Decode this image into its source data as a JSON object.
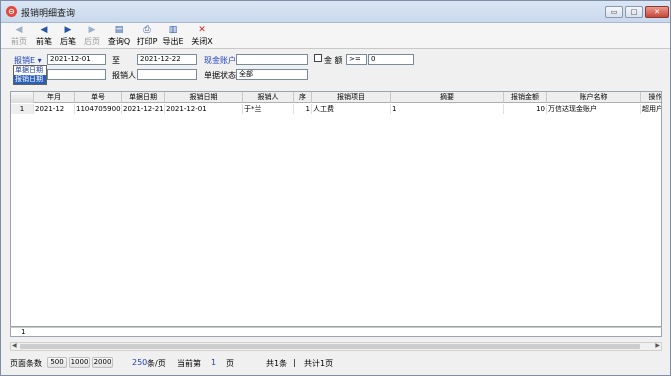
{
  "window": {
    "title": "报销明细查询",
    "app_icon_glyph": "⊖",
    "controls": {
      "minimize": "▭",
      "maximize": "□",
      "close": "✕"
    }
  },
  "toolbar": {
    "first": {
      "label": "前页",
      "icon": "◀"
    },
    "prev": {
      "label": "前笔",
      "icon": "◀"
    },
    "next": {
      "label": "后笔",
      "icon": "▶"
    },
    "last": {
      "label": "后页",
      "icon": "▶"
    },
    "query": {
      "label": "查询Q",
      "icon": "▤"
    },
    "print": {
      "label": "打印P",
      "icon": "⎙"
    },
    "export": {
      "label": "导出E",
      "icon": "▥"
    },
    "close": {
      "label": "关闭X",
      "icon": "✕"
    }
  },
  "filters": {
    "date_type": {
      "value": "报销E",
      "arrow": "▾"
    },
    "date_type_options": [
      "单据日期",
      "报销日期"
    ],
    "date_from": "2021-12-01",
    "to_label": "至",
    "date_to": "2021-12-22",
    "account_label": "现金账户",
    "account_value": "",
    "amount_label": "金 额",
    "amount_operator": ">=",
    "amount_value": "0",
    "reimburser_label": "报销人",
    "reimburser_value": "",
    "doc_status_label": "单据状态",
    "doc_status_value": "全部",
    "extra_value": ""
  },
  "grid": {
    "columns": [
      "年月",
      "单号",
      "单据日期",
      "报销日期",
      "报销人",
      "序",
      "报销项目",
      "摘要",
      "报销金额",
      "账户名称",
      "操作"
    ],
    "rows": [
      {
        "num": "1",
        "cells": [
          "2021-12",
          "1104705900",
          "2021-12-21",
          "2021-12-01",
          "于*兰",
          "1",
          "人工费",
          "1",
          "10",
          "万信达现金账户",
          "超用户"
        ]
      }
    ],
    "footer_count": "1"
  },
  "status": {
    "page_size_label": "页面条数",
    "page_size_options": [
      "500",
      "1000",
      "2000"
    ],
    "page_size_value": "250",
    "page_size_unit": "条/页",
    "current_label": "当前第",
    "current_page": "1",
    "page_unit": "页",
    "total_records": "共1条",
    "separator": "|",
    "total_pages": "共计1页"
  }
}
